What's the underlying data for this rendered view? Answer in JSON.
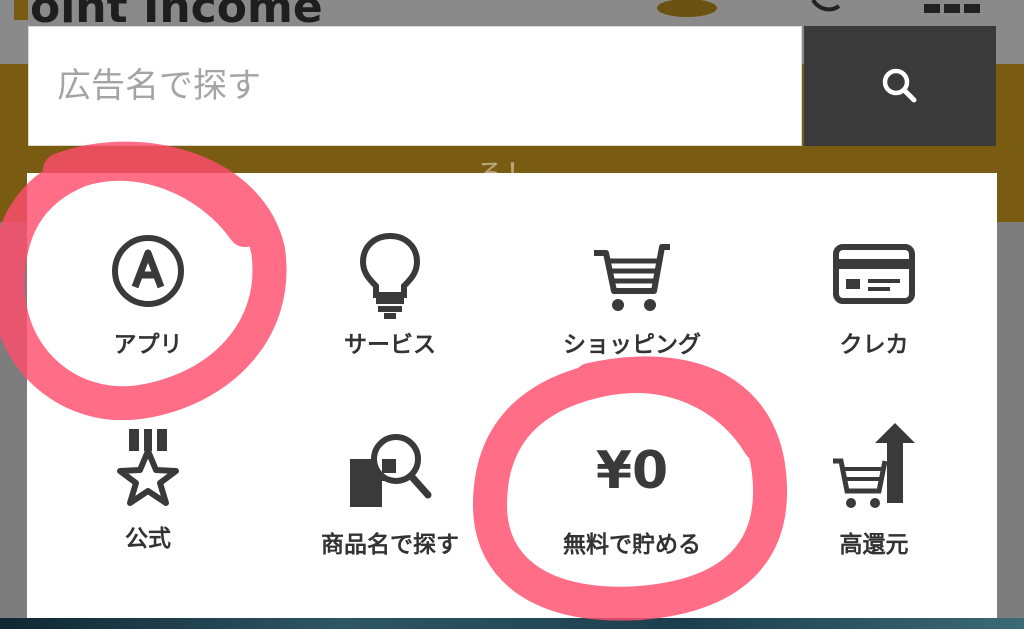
{
  "app": {
    "logo_text": "oint Income"
  },
  "background": {
    "banner_text": "ろ！"
  },
  "search": {
    "placeholder": "広告名で探す"
  },
  "categories": [
    {
      "label": "アプリ",
      "icon": "app-a-circle-icon"
    },
    {
      "label": "サービス",
      "icon": "lightbulb-icon"
    },
    {
      "label": "ショッピング",
      "icon": "shopping-cart-icon"
    },
    {
      "label": "クレカ",
      "icon": "credit-card-icon"
    },
    {
      "label": "公式",
      "icon": "medal-star-icon"
    },
    {
      "label": "商品名で探す",
      "icon": "product-search-icon"
    },
    {
      "label": "無料で貯める",
      "icon": "yen-zero-icon",
      "icon_text": "¥0"
    },
    {
      "label": "高還元",
      "icon": "cart-up-arrow-icon"
    }
  ],
  "colors": {
    "search_button": "#3a3a3a",
    "banner": "#7a5b12",
    "highlight_circle": "#ff4d6d"
  }
}
